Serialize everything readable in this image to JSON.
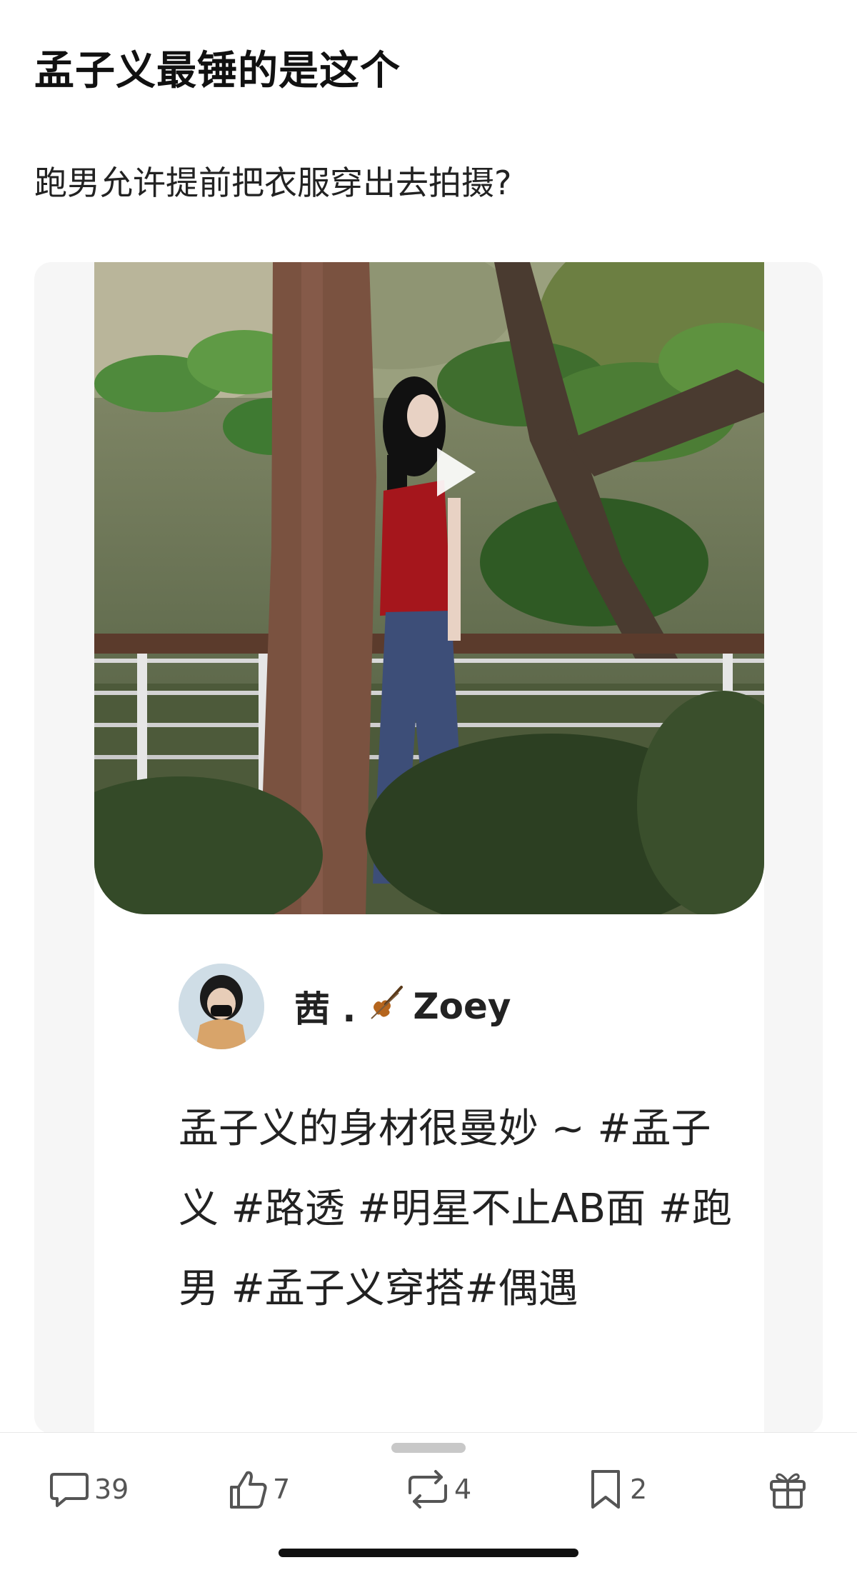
{
  "post": {
    "title": "孟子义最锤的是这个",
    "body": "跑男允许提前把衣服穿出去拍摄?"
  },
  "embedded": {
    "author_name_prefix": "茜 .",
    "author_name_suffix": "Zoey",
    "caption": "孟子义的身材很曼妙 ~ #孟子义 #路透 #明星不止AB面 #跑男 #孟子义穿搭#偶遇",
    "photo_icons": {
      "play": "play-icon"
    }
  },
  "actions": {
    "comment": {
      "icon": "comment-icon",
      "count": "39"
    },
    "like": {
      "icon": "thumbs-up-icon",
      "count": "7"
    },
    "repost": {
      "icon": "repost-icon",
      "count": "4"
    },
    "bookmark": {
      "icon": "bookmark-icon",
      "count": "2"
    },
    "gift": {
      "icon": "gift-icon"
    }
  },
  "colors": {
    "text": "#111111",
    "icon": "#555555",
    "top_color": "#a5161c",
    "jeans_color": "#3d4e78"
  }
}
